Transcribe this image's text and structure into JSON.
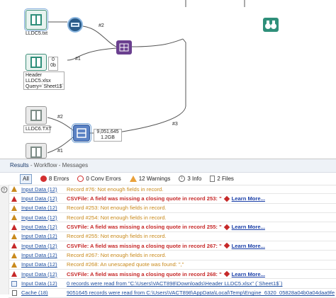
{
  "canvas": {
    "tools": {
      "input1_caption": "LLDC5.txt",
      "input2_caption": "Header\nLLDC5.xlsx\nQuery=`Sheet1$`",
      "input3_caption": "LLDC6.TXT",
      "select_badge_top": "0",
      "select_badge_bottom": "0b",
      "union_record_count": "9,051,645",
      "union_size": "1.2GB"
    },
    "connections": {
      "c2_top": "#2",
      "c1_mid": "#1",
      "c2_low": "#2",
      "c3": "#3",
      "c1_low": "#1"
    }
  },
  "results": {
    "title": "Results",
    "subtitle": " - Workflow - Messages",
    "filters": {
      "all": "All",
      "errors": "8 Errors",
      "conv_errors": "0 Conv Errors",
      "warnings": "12 Warnings",
      "info": "3 Info",
      "files": "2 Files"
    },
    "rows": [
      {
        "tool": "Input Data (12)",
        "msg": "Record #76: Not enough fields in record.",
        "type": "warn",
        "learn": ""
      },
      {
        "tool": "Input Data (12)",
        "msg": "CSVFile: A field was missing a closing quote in record 253: \"",
        "type": "err",
        "learn": "Learn More..."
      },
      {
        "tool": "Input Data (12)",
        "msg": "Record #253: Not enough fields in record.",
        "type": "warn",
        "learn": ""
      },
      {
        "tool": "Input Data (12)",
        "msg": "Record #254: Not enough fields in record.",
        "type": "warn",
        "learn": ""
      },
      {
        "tool": "Input Data (12)",
        "msg": "CSVFile: A field was missing a closing quote in record 255: \"",
        "type": "err",
        "learn": "Learn More..."
      },
      {
        "tool": "Input Data (12)",
        "msg": "Record #255: Not enough fields in record.",
        "type": "warn",
        "learn": ""
      },
      {
        "tool": "Input Data (12)",
        "msg": "CSVFile: A field was missing a closing quote in record 267: \"",
        "type": "err",
        "learn": "Learn More..."
      },
      {
        "tool": "Input Data (12)",
        "msg": "Record #267: Not enough fields in record.",
        "type": "warn",
        "learn": ""
      },
      {
        "tool": "Input Data (12)",
        "msg": "Record #268: An unescaped quote was found: \",\"",
        "type": "warn",
        "learn": ""
      },
      {
        "tool": "Input Data (12)",
        "msg": "CSVFile: A field was missing a closing quote in record 268: \"",
        "type": "err",
        "learn": "Learn More..."
      },
      {
        "tool": "Input Data (12)",
        "msg": "0 records were read from \"C:\\Users\\VACT898\\Downloads\\Header LLDC5.xlsx\" (`Sheet1$`)",
        "type": "info",
        "learn": ""
      },
      {
        "tool": "Cache (18)",
        "msg": "9051645 records were read from C:\\Users\\VACT898\\AppData\\Local\\Temp\\Engine_6320_05828a04b0a04daa9fe",
        "type": "info",
        "learn": ""
      }
    ]
  }
}
